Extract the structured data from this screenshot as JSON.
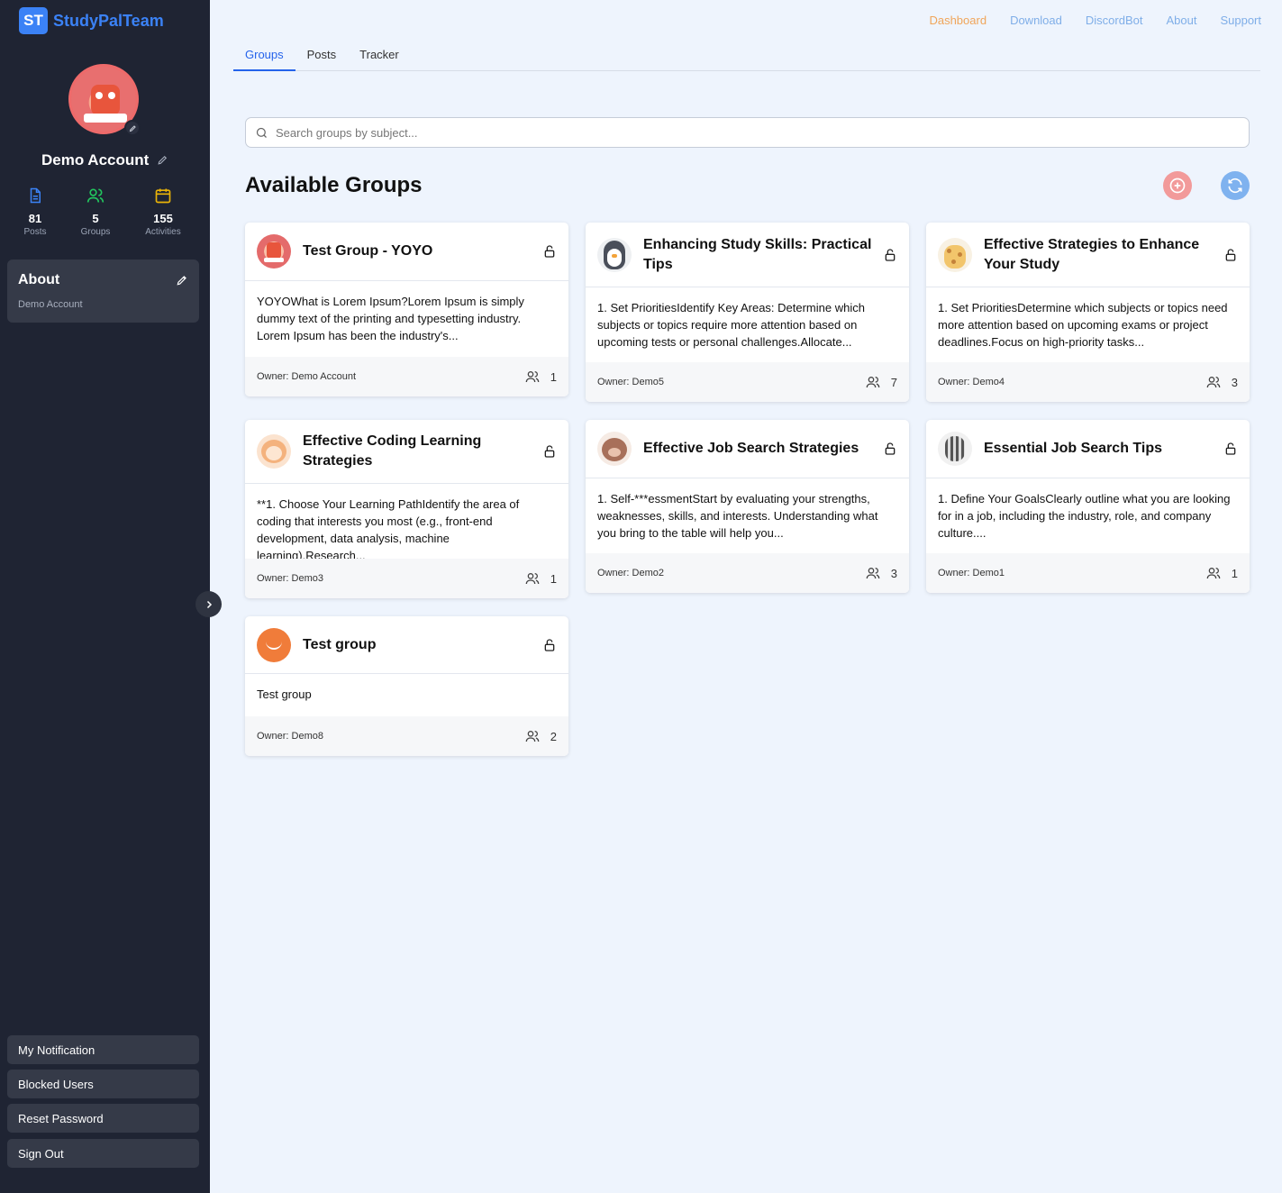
{
  "brand": {
    "logo": "ST",
    "name": "StudyPalTeam"
  },
  "profile": {
    "name": "Demo Account"
  },
  "stats": [
    {
      "value": "81",
      "label": "Posts",
      "icon": "document-icon",
      "color": "#3b82f6"
    },
    {
      "value": "5",
      "label": "Groups",
      "icon": "users-icon",
      "color": "#22c55e"
    },
    {
      "value": "155",
      "label": "Activities",
      "icon": "calendar-icon",
      "color": "#eab308"
    }
  ],
  "about": {
    "title": "About",
    "subtitle": "Demo Account"
  },
  "side_buttons": [
    "My Notification",
    "Blocked Users",
    "Reset Password",
    "Sign Out"
  ],
  "topnav": [
    "Dashboard",
    "Download",
    "DiscordBot",
    "About",
    "Support"
  ],
  "tabs": [
    "Groups",
    "Posts",
    "Tracker"
  ],
  "search": {
    "placeholder": "Search groups by subject..."
  },
  "section_title": "Available Groups",
  "colors": {
    "accent": "#2563eb",
    "active_nav": "#f0a55a",
    "nav": "#7faee8",
    "sidebar": "#1f2433"
  },
  "groups": [
    {
      "title": "Test Group - YOYO",
      "desc": "YOYOWhat is Lorem Ipsum?Lorem Ipsum is simply dummy text of the printing and typesetting industry. Lorem Ipsum has been the industry's...",
      "owner": "Owner: Demo Account",
      "members": "1",
      "avatar": "robot"
    },
    {
      "title": "Enhancing Study Skills: Practical Tips",
      "desc": "1. Set PrioritiesIdentify Key Areas: Determine which subjects or topics require more attention based on upcoming tests or personal challenges.Allocate...",
      "owner": "Owner: Demo5",
      "members": "7",
      "avatar": "penguin"
    },
    {
      "title": "Effective Strategies to Enhance Your Study",
      "desc": "1. Set PrioritiesDetermine which subjects or topics need more attention based on upcoming exams or project deadlines.Focus on high-priority tasks...",
      "owner": "Owner: Demo4",
      "members": "3",
      "avatar": "giraffe"
    },
    {
      "title": "Effective Coding Learning Strategies",
      "desc": "**1. Choose Your Learning PathIdentify the area of coding that interests you most (e.g., front-end development, data analysis, machine learning).Research...",
      "owner": "Owner: Demo3",
      "members": "1",
      "avatar": "monkey"
    },
    {
      "title": "Effective Job Search Strategies",
      "desc": "1. Self-***essmentStart by evaluating your strengths, weaknesses, skills, and interests. Understanding what you bring to the table will help you...",
      "owner": "Owner: Demo2",
      "members": "3",
      "avatar": "bear"
    },
    {
      "title": "Essential Job Search Tips",
      "desc": "1. Define Your GoalsClearly outline what you are looking for in a job, including the industry, role, and company culture....",
      "owner": "Owner: Demo1",
      "members": "1",
      "avatar": "zebra"
    },
    {
      "title": "Test group",
      "desc": "Test group",
      "owner": "Owner: Demo8",
      "members": "2",
      "avatar": "orange"
    }
  ]
}
